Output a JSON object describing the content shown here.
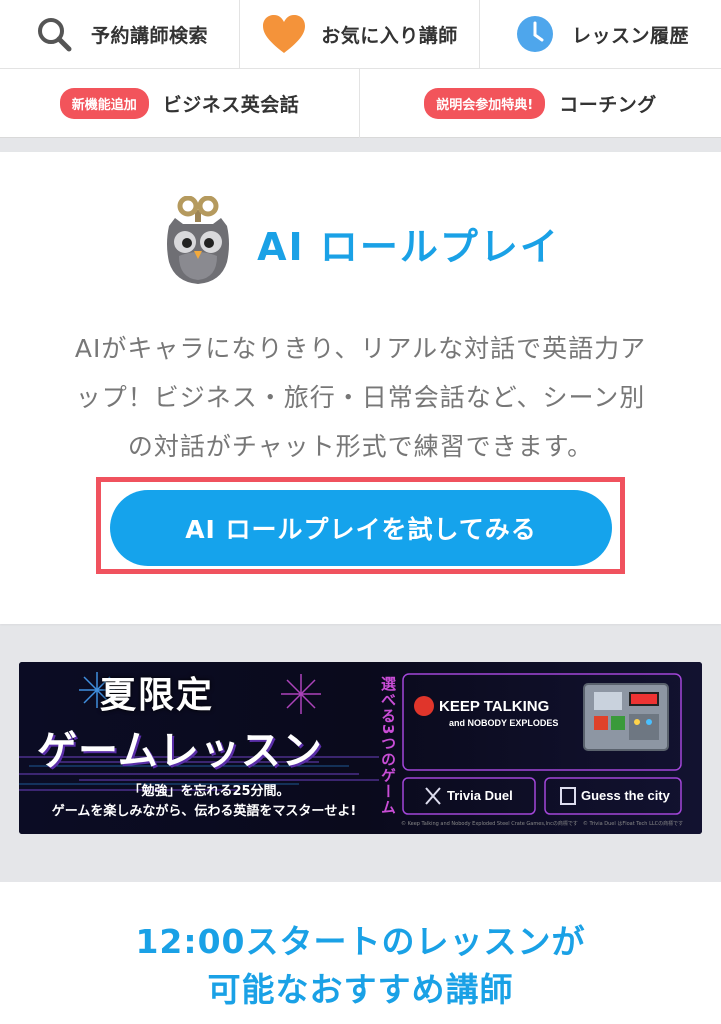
{
  "nav": {
    "row1": [
      {
        "label": "予約講師検索",
        "icon": "search-icon"
      },
      {
        "label": "お気に入り講師",
        "icon": "heart-icon"
      },
      {
        "label": "レッスン履歴",
        "icon": "clock-icon"
      }
    ],
    "row2": [
      {
        "badge": "新機能追加",
        "label": "ビジネス英会話"
      },
      {
        "badge": "説明会参加特典!",
        "label": "コーチング"
      }
    ]
  },
  "roleplay": {
    "title": "AI ロールプレイ",
    "description_line1": "AIがキャラになりきり、リアルな対話で英語力ア",
    "description_line2": "ップ！ビジネス・旅行・日常会話など、シーン別",
    "description_line3": "の対話がチャット形式で練習できます。",
    "cta_label": "AI ロールプレイを試してみる"
  },
  "banner": {
    "headline1": "夏限定",
    "headline2": "ゲームレッスン",
    "sub1": "「勉強」を忘れる25分間。",
    "sub2": "ゲームを楽しみながら、伝わる英語をマスターせよ!",
    "vertical": "選べる3つのゲーム",
    "game1_line1": "KEEP TALKING",
    "game1_line2": "and NOBODY EXPLODES",
    "game2": "Trivia Duel",
    "game3": "Guess the city",
    "fineprint": "© Keep Talking and Nobody Exploded Steel Crate Games,Incの商標です　© Trivia Duel はFloat Tech LLCの商標です",
    "colors": {
      "accent": "#c94dd6",
      "gold": "#f5d36b"
    }
  },
  "recommend": {
    "title_line1": "12:00スタートのレッスンが",
    "title_line2": "可能なおすすめ講師"
  },
  "colors": {
    "brand_blue": "#1aa1e6",
    "badge_red": "#f2545b",
    "heart_orange": "#f4933a"
  }
}
